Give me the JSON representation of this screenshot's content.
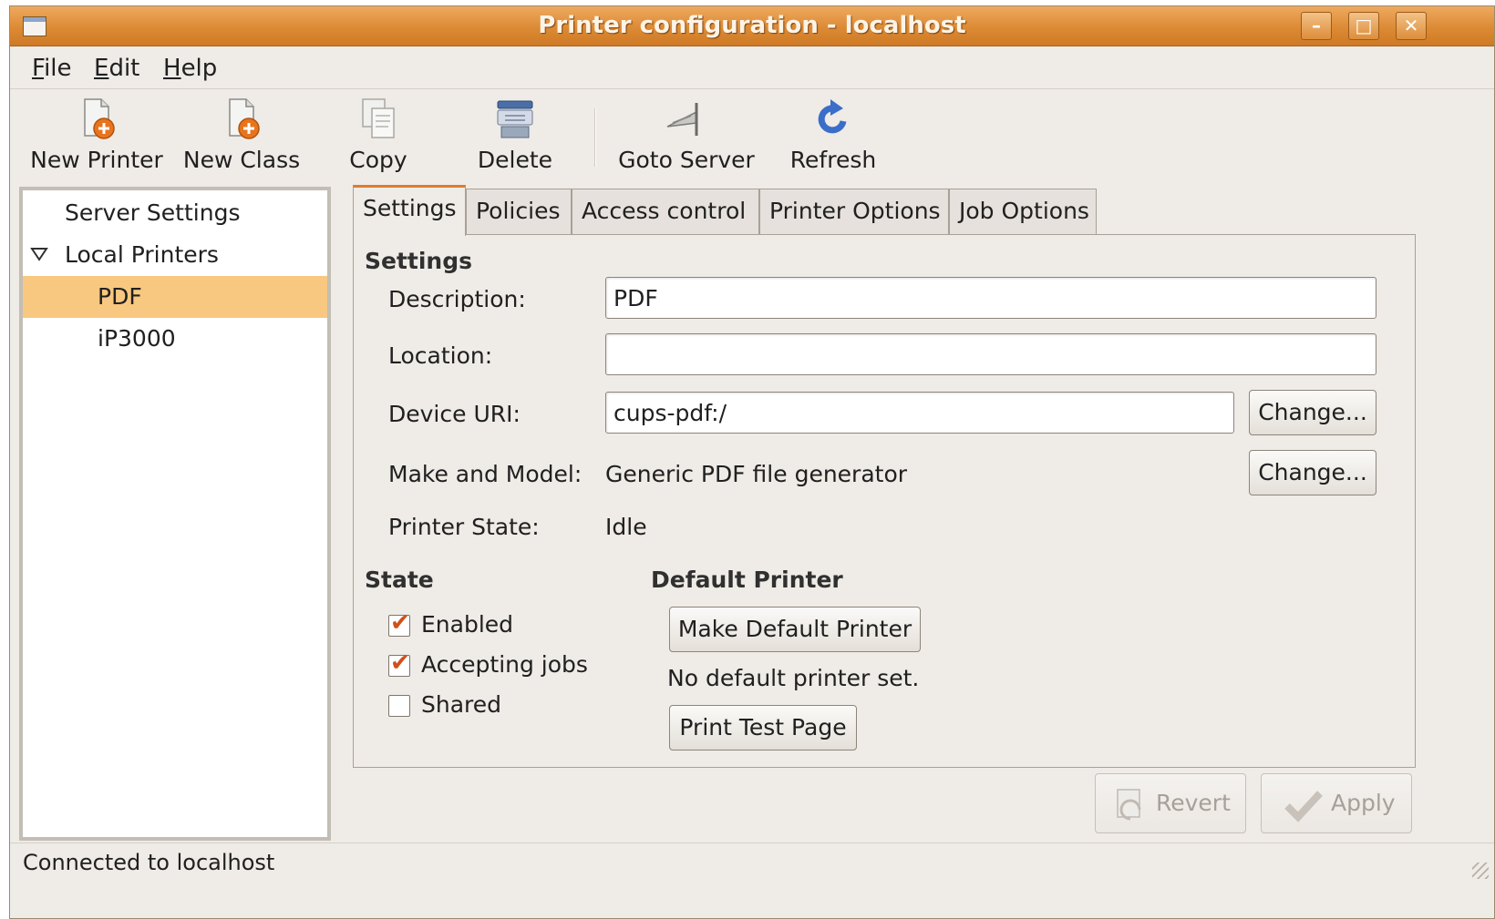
{
  "window": {
    "title": "Printer configuration - localhost"
  },
  "menubar": {
    "items": [
      {
        "mnemonic": "F",
        "rest": "ile"
      },
      {
        "mnemonic": "E",
        "rest": "dit"
      },
      {
        "mnemonic": "H",
        "rest": "elp"
      }
    ]
  },
  "toolbar": {
    "new_printer": "New Printer",
    "new_class": "New Class",
    "copy": "Copy",
    "delete": "Delete",
    "goto_server": "Goto Server",
    "refresh": "Refresh"
  },
  "tree": {
    "server_settings": "Server Settings",
    "local_printers": "Local Printers",
    "printers": [
      "PDF",
      "iP3000"
    ]
  },
  "tabs": [
    "Settings",
    "Policies",
    "Access control",
    "Printer Options",
    "Job Options"
  ],
  "settings": {
    "section_title": "Settings",
    "description_label": "Description:",
    "description_value": "PDF",
    "location_label": "Location:",
    "location_value": "",
    "device_uri_label": "Device URI:",
    "device_uri_value": "cups-pdf:/",
    "change_label": "Change...",
    "make_model_label": "Make and Model:",
    "make_model_value": "Generic PDF file generator",
    "printer_state_label": "Printer State:",
    "printer_state_value": "Idle"
  },
  "state": {
    "section_title": "State",
    "enabled_label": "Enabled",
    "enabled_checked": true,
    "accepting_label": "Accepting jobs",
    "accepting_checked": true,
    "shared_label": "Shared",
    "shared_checked": false
  },
  "default_printer": {
    "section_title": "Default Printer",
    "make_default_label": "Make Default Printer",
    "status_text": "No default printer set.",
    "print_test_label": "Print Test Page"
  },
  "actions": {
    "revert": "Revert",
    "apply": "Apply"
  },
  "status": {
    "text": "Connected to localhost"
  },
  "colors": {
    "accent": "#e07b2a",
    "selection": "#f8c780",
    "titlebar": "#dc8a34"
  }
}
